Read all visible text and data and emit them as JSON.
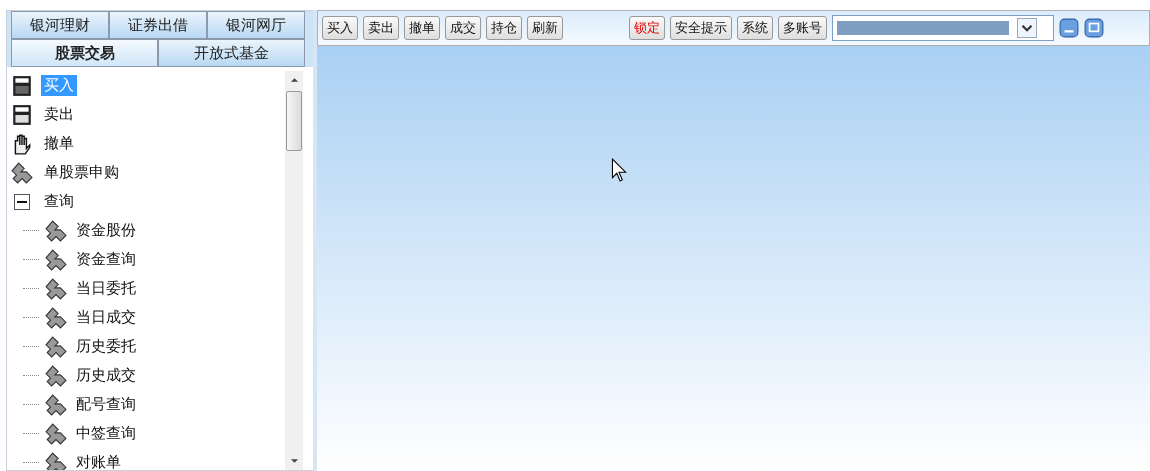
{
  "tabs_top": [
    {
      "label": "银河理财",
      "selected": false
    },
    {
      "label": "证券出借",
      "selected": false
    },
    {
      "label": "银河网厅",
      "selected": false
    }
  ],
  "tabs_bottom": [
    {
      "label": "股票交易",
      "selected": true
    },
    {
      "label": "开放式基金",
      "selected": false
    }
  ],
  "tree": [
    {
      "label": "买入",
      "kind": "buy",
      "selected": true
    },
    {
      "label": "卖出",
      "kind": "sell",
      "selected": false
    },
    {
      "label": "撤单",
      "kind": "hand",
      "selected": false
    },
    {
      "label": "单股票申购",
      "kind": "gem",
      "selected": false
    },
    {
      "label": "查询",
      "kind": "folder",
      "selected": false,
      "expanded": true,
      "children": [
        {
          "label": "资金股份",
          "kind": "gem",
          "selected": false
        },
        {
          "label": "资金查询",
          "kind": "gem",
          "selected": false
        },
        {
          "label": "当日委托",
          "kind": "gem",
          "selected": false
        },
        {
          "label": "当日成交",
          "kind": "gem",
          "selected": false
        },
        {
          "label": "历史委托",
          "kind": "gem",
          "selected": false
        },
        {
          "label": "历史成交",
          "kind": "gem",
          "selected": false
        },
        {
          "label": "配号查询",
          "kind": "gem",
          "selected": false
        },
        {
          "label": "中签查询",
          "kind": "gem",
          "selected": false
        },
        {
          "label": "对账单",
          "kind": "gem",
          "selected": false
        }
      ]
    }
  ],
  "toolbar_left": [
    {
      "label": "买入",
      "alert": false
    },
    {
      "label": "卖出",
      "alert": false
    },
    {
      "label": "撤单",
      "alert": false
    },
    {
      "label": "成交",
      "alert": false
    },
    {
      "label": "持仓",
      "alert": false
    },
    {
      "label": "刷新",
      "alert": false
    }
  ],
  "toolbar_right": [
    {
      "label": "锁定",
      "alert": true
    },
    {
      "label": "安全提示",
      "alert": false
    },
    {
      "label": "系统",
      "alert": false
    },
    {
      "label": "多账号",
      "alert": false
    }
  ]
}
